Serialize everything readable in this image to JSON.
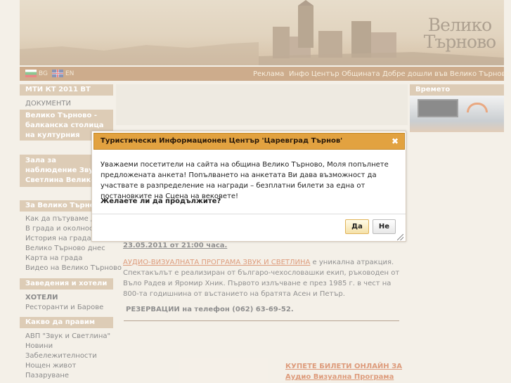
{
  "header": {
    "logo_line1": "Велико",
    "logo_line2": "Търново"
  },
  "languages": {
    "bg": "BG",
    "en": "EN"
  },
  "top_nav": [
    {
      "label": "Реклама"
    },
    {
      "label": "Инфо Център"
    },
    {
      "label": "Общината"
    },
    {
      "label": "Добре дошли във Велико Търново!"
    }
  ],
  "left": {
    "head1": "МТИ КТ 2011 ВТ",
    "documents": "ДОКУМЕНТИ",
    "capital_block": "Велико Търново - балканска столица на културния туризъм",
    "hall_block": "Зала за наблюдение Звук и Светлина Велико Търново",
    "about_head": "За Велико Търново",
    "about_items": [
      "Как да пътуваме до",
      "В града и околностите",
      "История на града",
      "Велико Търново днес",
      "Карта на града",
      "Видео на Велико Търново"
    ],
    "venues_head": "Заведения и хотели",
    "venues_items": [
      "ХОТЕЛИ",
      "Ресторанти и Барове"
    ],
    "todo_head": "Какво да правим",
    "todo_items": [
      "АВП \"Звук и Светлина\"",
      "Новини",
      "Забележителности",
      "Нощен живот",
      "Пазаруване"
    ]
  },
  "center": {
    "date_line": "23.05.2011 от 21:00 часа.",
    "program_link": "АУДИО-ВИЗУАЛНАТА ПРОГРАМА ЗВУК И СВЕТЛИНА",
    "program_text": " е уникална атракция. Спектакълът е реализиран от българо-чехословашки екип, ръководен от Вълo Радев и Яромир Хник. Първото излъчване е през 1985 г. в чест на 800-та годишнина от въстанието на братята Асен и Петър.",
    "reservations": "РЕЗЕРВАЦИИ на телефон (062) 63-69-52.",
    "buy_line1": "КУПЕТЕ БИЛЕТИ ОНЛАЙН ЗА",
    "buy_line2": "Аудио Визуална Програма"
  },
  "right": {
    "weather_head": "Времето"
  },
  "dialog": {
    "title": "Туристически Информационен Център 'Царевград Търнов'",
    "close": "✖",
    "body": "Уважаеми посетители на сайта на община Велико Търново, Моля попълнете предложената анкета! Попълването на анкетата Ви дава възможност да участвате в разпределение на награди – безплатни билети за една от постановките на Сцена на вековете!",
    "question": "Желаете ли да продължите?",
    "yes": "Да",
    "no": "Не"
  },
  "colors": {
    "nav": "#a5692f",
    "panel_head": "#c2a27a",
    "dialog_title": "#e2a240"
  }
}
